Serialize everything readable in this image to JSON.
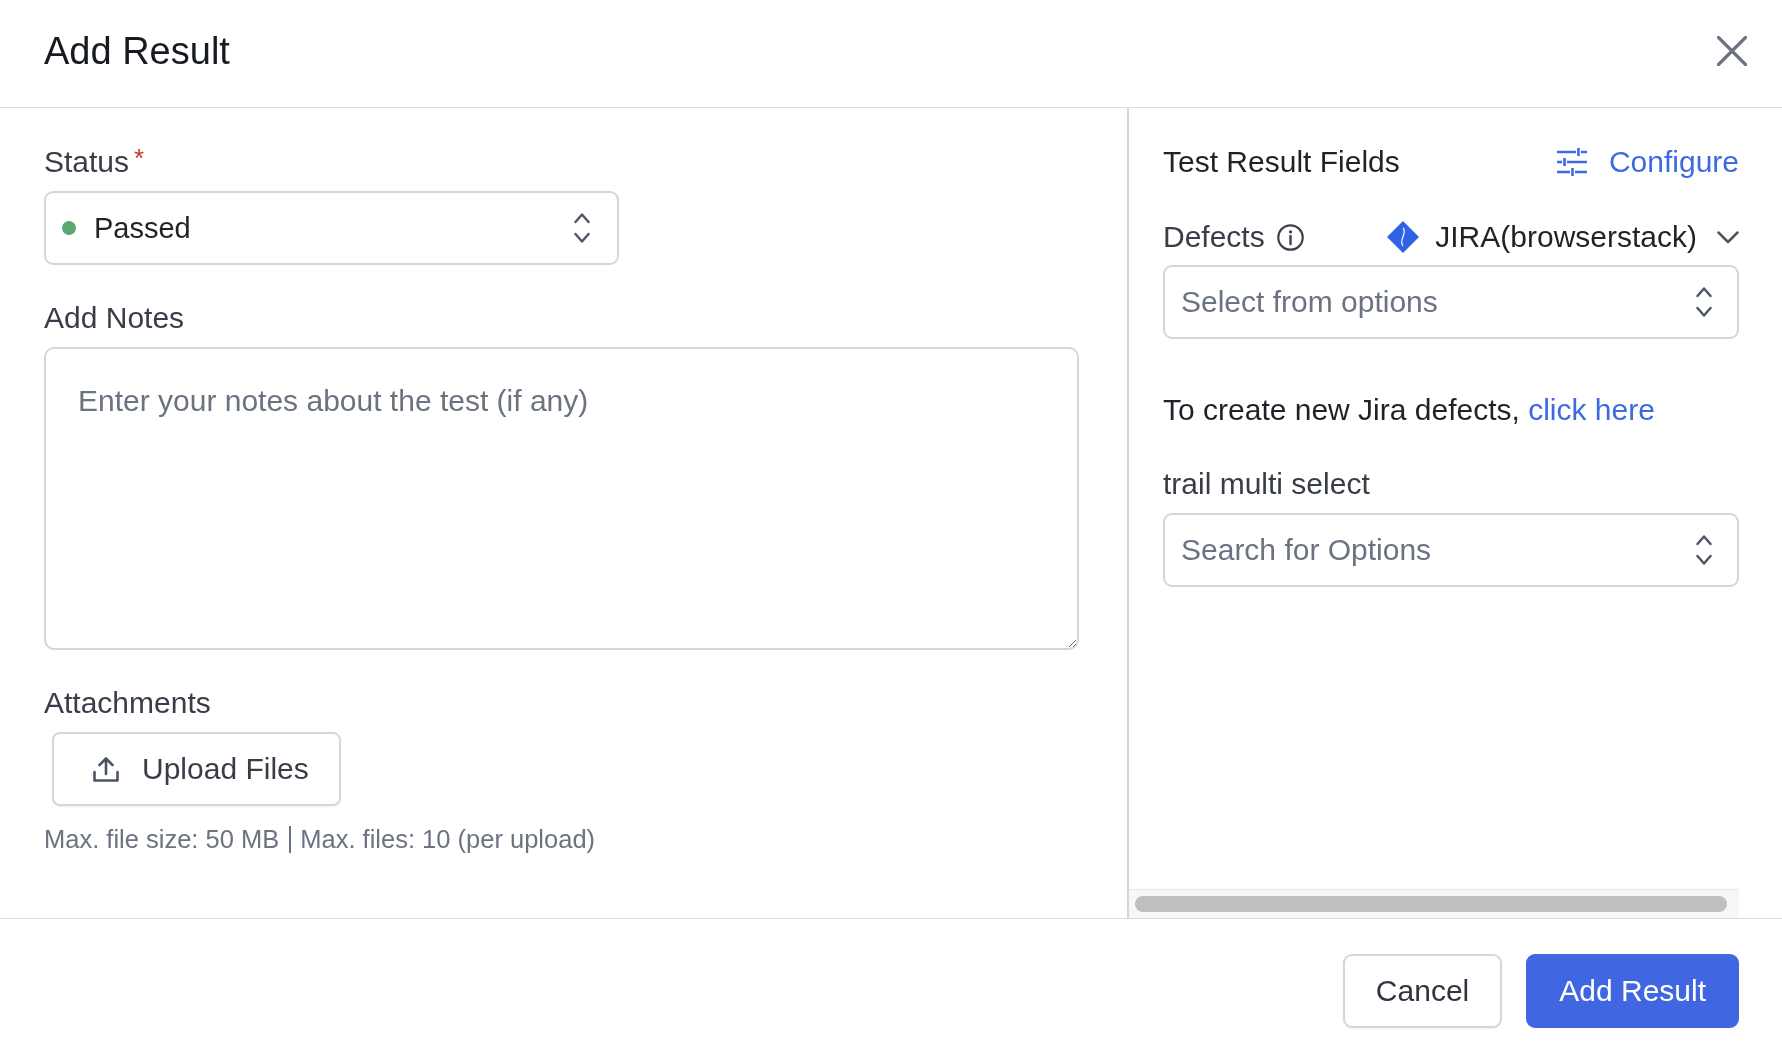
{
  "dialog": {
    "title": "Add Result"
  },
  "status": {
    "label": "Status",
    "required_mark": "*",
    "value": "Passed",
    "color": "#5ba871"
  },
  "notes": {
    "label": "Add Notes",
    "placeholder": "Enter your notes about the test (if any)"
  },
  "attachments": {
    "label": "Attachments",
    "upload_button": "Upload Files",
    "limits": [
      "Max. file size: 50 MB",
      "Max. files: 10 (per upload)"
    ]
  },
  "fields_panel": {
    "title": "Test Result Fields",
    "configure": "Configure",
    "defects": {
      "label": "Defects",
      "tracker": "JIRA(browserstack)",
      "placeholder": "Select from options",
      "hint": "To create new Jira defects,",
      "hint_link": "click here"
    },
    "custom_fields": [
      {
        "label": "trail multi select",
        "placeholder": "Search for Options"
      }
    ]
  },
  "buttons": [
    {
      "label": "Cancel",
      "kind": "secondary"
    },
    {
      "label": "Add Result",
      "kind": "primary"
    }
  ]
}
